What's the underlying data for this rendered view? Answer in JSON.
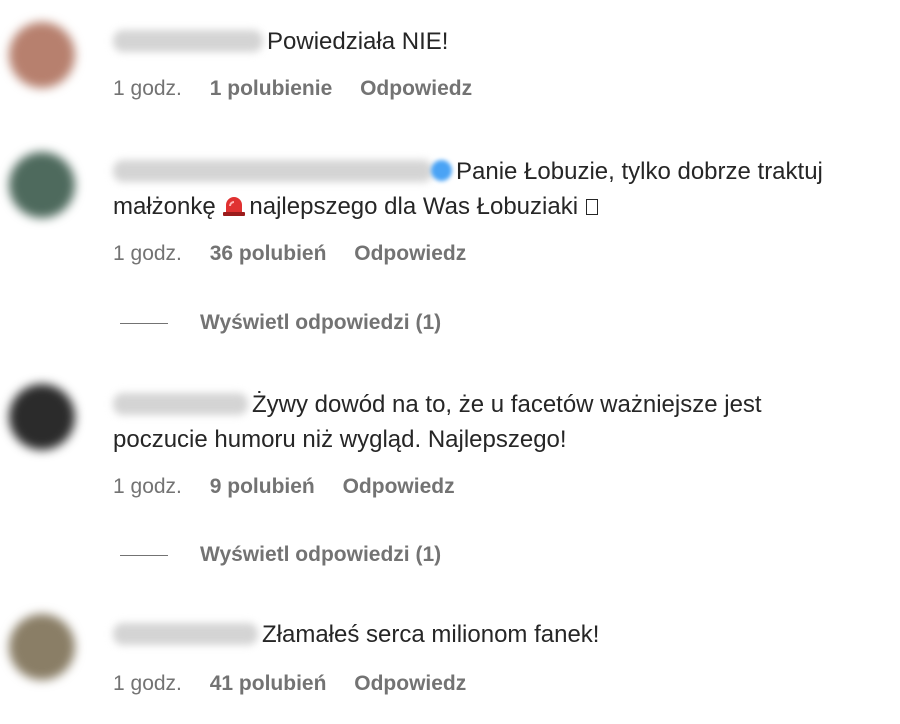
{
  "comments": [
    {
      "text": "Powiedziała NIE!",
      "time": "1 godz.",
      "likes": "1 polubienie",
      "reply": "Odpowiedz",
      "avatar_color": "#b7806e"
    },
    {
      "text_line1": "Panie Łobuzie, tylko dobrze traktuj",
      "text_pre_icon": "małżonkę",
      "text_post_icon": "najlepszego dla Was Łobuziaki",
      "time": "1 godz.",
      "likes": "36 polubień",
      "reply": "Odpowiedz",
      "view_replies": "Wyświetl odpowiedzi (1)",
      "avatar_color": "#4e6a5d",
      "icon": "police-light-icon"
    },
    {
      "text_line1": "Żywy dowód na to, że u facetów ważniejsze jest",
      "text_line2": "poczucie humoru niż wygląd. Najlepszego!",
      "time": "1 godz.",
      "likes": "9 polubień",
      "reply": "Odpowiedz",
      "view_replies": "Wyświetl odpowiedzi (1)",
      "avatar_color": "#2b2b2b"
    },
    {
      "text": "Złamałeś serca milionom fanek!",
      "time": "1 godz.",
      "likes": "41 polubień",
      "reply": "Odpowiedz",
      "avatar_color": "#8a7e66"
    }
  ],
  "colors": {
    "text": "#262626",
    "secondary": "#737373",
    "verified": "#4aa3f5"
  }
}
